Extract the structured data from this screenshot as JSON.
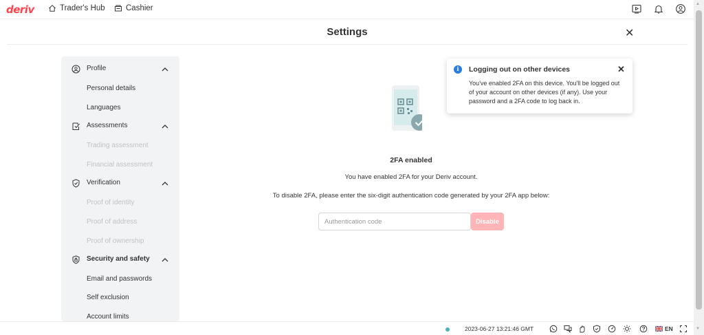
{
  "header": {
    "logo": "deriv",
    "nav": [
      {
        "label": "Trader's Hub"
      },
      {
        "label": "Cashier"
      }
    ]
  },
  "settings": {
    "title": "Settings"
  },
  "sidebar": {
    "sections": [
      {
        "label": "Profile",
        "items": [
          {
            "label": "Personal details",
            "disabled": false
          },
          {
            "label": "Languages",
            "disabled": false
          }
        ]
      },
      {
        "label": "Assessments",
        "items": [
          {
            "label": "Trading assessment",
            "disabled": true
          },
          {
            "label": "Financial assessment",
            "disabled": true
          }
        ]
      },
      {
        "label": "Verification",
        "items": [
          {
            "label": "Proof of identity",
            "disabled": true
          },
          {
            "label": "Proof of address",
            "disabled": true
          },
          {
            "label": "Proof of ownership",
            "disabled": true
          }
        ]
      },
      {
        "label": "Security and safety",
        "items": [
          {
            "label": "Email and passwords",
            "disabled": false
          },
          {
            "label": "Self exclusion",
            "disabled": false
          },
          {
            "label": "Account limits",
            "disabled": false
          }
        ]
      }
    ]
  },
  "main": {
    "status_title": "2FA enabled",
    "description": "You have enabled 2FA for your Deriv account.",
    "instruction": "To disable 2FA, please enter the six-digit authentication code generated by your 2FA app below:",
    "code_placeholder": "Authentication code",
    "disable_button": "Disable"
  },
  "toast": {
    "title": "Logging out on other devices",
    "body": "You've enabled 2FA on this device. You'll be logged out of your account on other devices (if any). Use your password and a 2FA code to log back in."
  },
  "footer": {
    "timestamp": "2023-06-27 13:21:46 GMT",
    "language": "EN"
  },
  "colors": {
    "brand": "#ff444f",
    "disabled_button": "#ffb4b8",
    "info": "#2a7de1",
    "status_online": "#4bb4b3"
  }
}
